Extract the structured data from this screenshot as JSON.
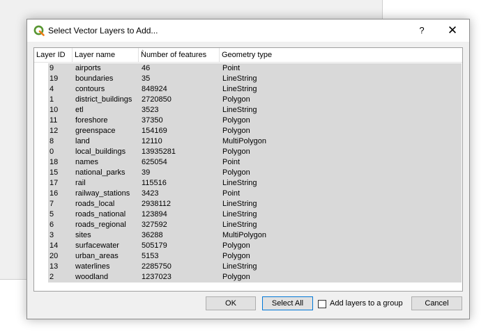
{
  "dialog": {
    "title": "Select Vector Layers to Add...",
    "help_label": "?",
    "close_label": "✕",
    "icon": "qgis-logo-icon"
  },
  "table": {
    "columns": [
      "Layer ID",
      "Layer name",
      "Number of features",
      "Geometry type"
    ],
    "rows": [
      {
        "id": "9",
        "name": "airports",
        "features": "46",
        "geometry": "Point"
      },
      {
        "id": "19",
        "name": "boundaries",
        "features": "35",
        "geometry": "LineString"
      },
      {
        "id": "4",
        "name": "contours",
        "features": "848924",
        "geometry": "LineString"
      },
      {
        "id": "1",
        "name": "district_buildings",
        "features": "2720850",
        "geometry": "Polygon"
      },
      {
        "id": "10",
        "name": "etl",
        "features": "3523",
        "geometry": "LineString"
      },
      {
        "id": "11",
        "name": "foreshore",
        "features": "37350",
        "geometry": "Polygon"
      },
      {
        "id": "12",
        "name": "greenspace",
        "features": "154169",
        "geometry": "Polygon"
      },
      {
        "id": "8",
        "name": "land",
        "features": "12110",
        "geometry": "MultiPolygon"
      },
      {
        "id": "0",
        "name": "local_buildings",
        "features": "13935281",
        "geometry": "Polygon"
      },
      {
        "id": "18",
        "name": "names",
        "features": "625054",
        "geometry": "Point"
      },
      {
        "id": "15",
        "name": "national_parks",
        "features": "39",
        "geometry": "Polygon"
      },
      {
        "id": "17",
        "name": "rail",
        "features": "115516",
        "geometry": "LineString"
      },
      {
        "id": "16",
        "name": "railway_stations",
        "features": "3423",
        "geometry": "Point"
      },
      {
        "id": "7",
        "name": "roads_local",
        "features": "2938112",
        "geometry": "LineString"
      },
      {
        "id": "5",
        "name": "roads_national",
        "features": "123894",
        "geometry": "LineString"
      },
      {
        "id": "6",
        "name": "roads_regional",
        "features": "327592",
        "geometry": "LineString"
      },
      {
        "id": "3",
        "name": "sites",
        "features": "36288",
        "geometry": "MultiPolygon"
      },
      {
        "id": "14",
        "name": "surfacewater",
        "features": "505179",
        "geometry": "Polygon"
      },
      {
        "id": "20",
        "name": "urban_areas",
        "features": "5153",
        "geometry": "Polygon"
      },
      {
        "id": "13",
        "name": "waterlines",
        "features": "2285750",
        "geometry": "LineString"
      },
      {
        "id": "2",
        "name": "woodland",
        "features": "1237023",
        "geometry": "Polygon"
      }
    ]
  },
  "buttons": {
    "ok": "OK",
    "select_all": "Select All",
    "add_to_group": "Add layers to a group",
    "add_to_group_checked": false,
    "cancel": "Cancel"
  },
  "colors": {
    "selection": "#d9d9d9",
    "default_button_border": "#0078d7",
    "qgis_green": "#589632",
    "qgis_yellow": "#ee7913"
  }
}
